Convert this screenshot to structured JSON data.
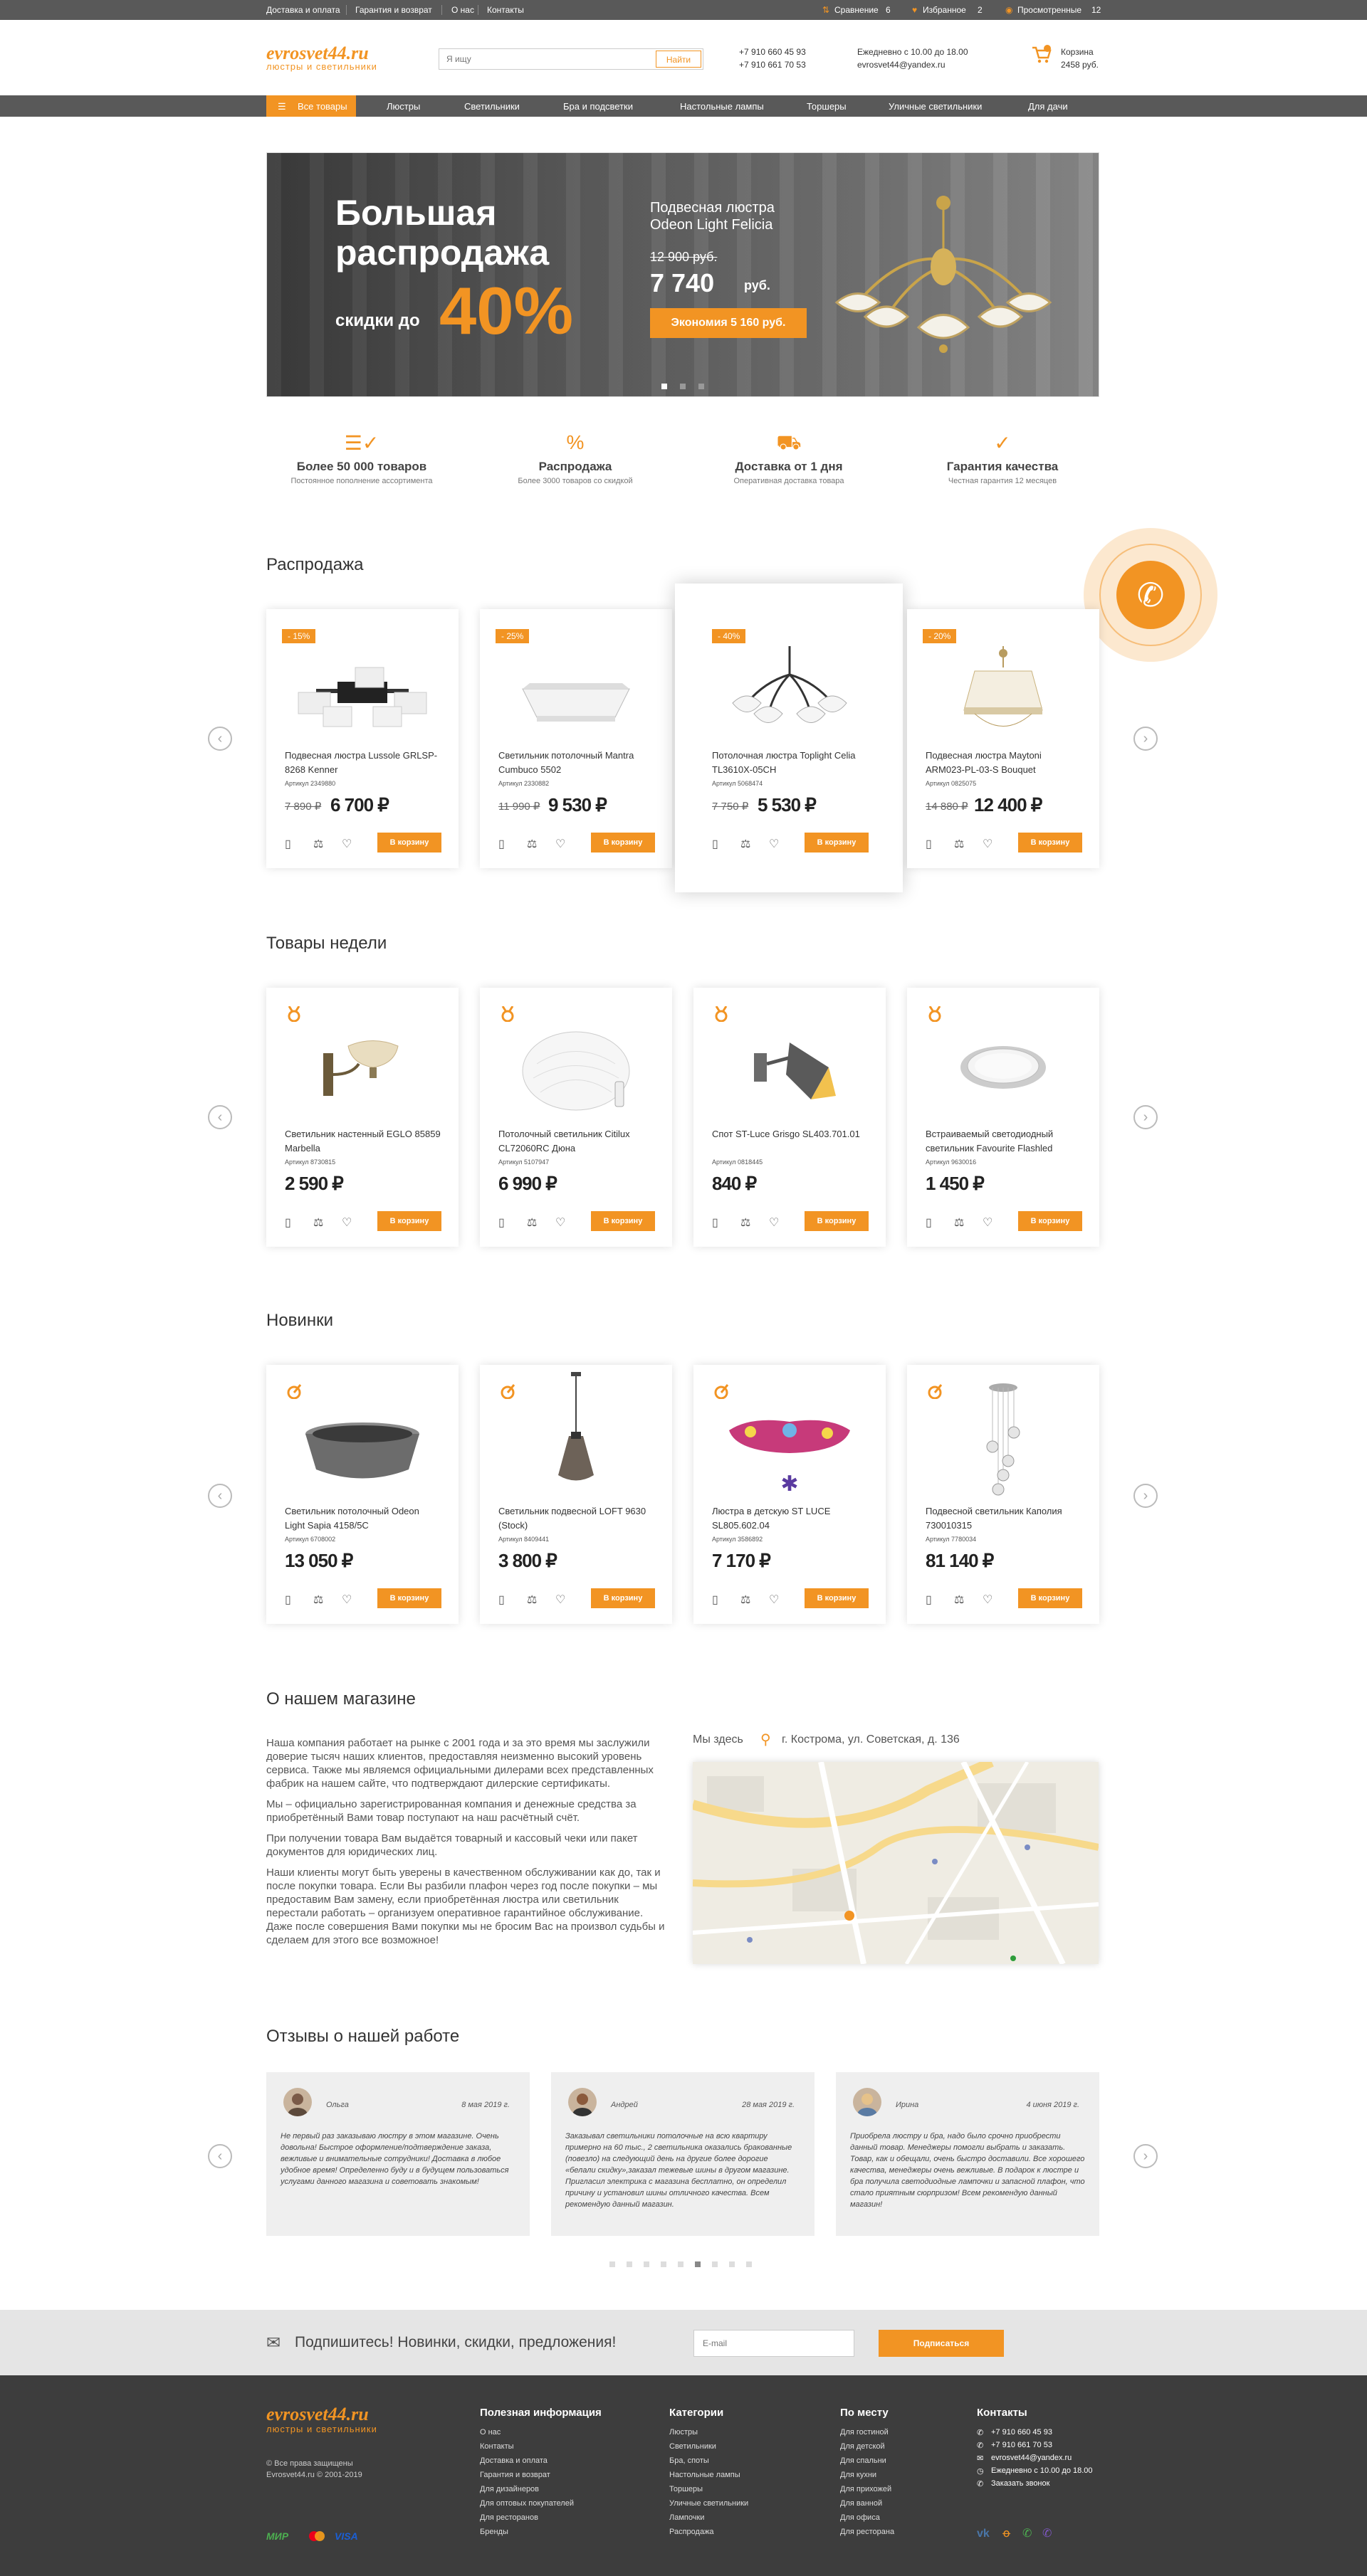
{
  "topbar": {
    "links": [
      "Доставка и оплата",
      "Гарантия и возврат",
      "О нас",
      "Контакты"
    ],
    "compare_label": "Сравнение",
    "compare_count": "6",
    "favorites_label": "Избранное",
    "favorites_count": "2",
    "viewed_label": "Просмотренные",
    "viewed_count": "12"
  },
  "header": {
    "logo_name": "evrosvet44.ru",
    "logo_sub": "люстры и светильники",
    "search_placeholder": "Я ищу",
    "search_button": "Найти",
    "phone1": "+7 910 660 45 93",
    "phone2": "+7 910 661 70 53",
    "hours": "Ежедневно с 10.00 до 18.00",
    "email": "evrosvet44@yandex.ru",
    "cart_label": "Корзина",
    "cart_sum": "2458 руб."
  },
  "nav": {
    "all": "Все товары",
    "items": [
      "Люстры",
      "Светильники",
      "Бра и подсветки",
      "Настольные лампы",
      "Торшеры",
      "Уличные светильники",
      "Для дачи"
    ]
  },
  "banner": {
    "line1": "Большая",
    "line2": "распродажа",
    "discount_prefix": "скидки до",
    "discount_value": "40%",
    "product_line1": "Подвесная люстра",
    "product_line2": "Odeon Light Felicia",
    "old_price": "12 900 руб.",
    "new_price": "7 740",
    "currency": "руб.",
    "economy": "Экономия 5 160 руб."
  },
  "features": [
    {
      "title": "Более 50 000 товаров",
      "sub": "Постоянное пополнение ассортимента",
      "icon": "checklist-icon"
    },
    {
      "title": "Распродажа",
      "sub": "Более 3000 товаров со скидкой",
      "icon": "percent-icon"
    },
    {
      "title": "Доставка от 1 дня",
      "sub": "Оперативная доставка товара",
      "icon": "truck-icon"
    },
    {
      "title": "Гарантия качества",
      "sub": "Честная гарантия 12 месяцев",
      "icon": "check-circle-icon"
    }
  ],
  "sale": {
    "title": "Распродажа",
    "items": [
      {
        "badge": "- 15%",
        "name": "Подвесная люстра Lussole GRLSP-8268 Kenner",
        "art": "Артикул 2349880",
        "old": "7 890 ₽",
        "price": "6 700 ₽"
      },
      {
        "badge": "- 25%",
        "name": "Светильник потолочный Mantra Cumbuco 5502",
        "art": "Артикул 2330882",
        "old": "11 990 ₽",
        "price": "9 530 ₽"
      },
      {
        "badge": "- 40%",
        "name": "Потолочная люстра Toplight Celia TL3610X-05CH",
        "art": "Артикул 5068474",
        "old": "7 750 ₽",
        "price": "5 530 ₽"
      },
      {
        "badge": "- 20%",
        "name": "Подвесная люстра Maytoni ARM023-PL-03-S Bouquet",
        "art": "Артикул 0825075",
        "old": "14 880 ₽",
        "price": "12 400 ₽"
      }
    ]
  },
  "week": {
    "title": "Товары недели",
    "items": [
      {
        "name": "Светильник настенный EGLO 85859 Marbella",
        "art": "Артикул 8730815",
        "price": "2 590 ₽"
      },
      {
        "name": "Потолочный светильник Citilux CL72060RC Дюна",
        "art": "Артикул 5107947",
        "price": "6 990 ₽"
      },
      {
        "name": "Спот ST-Luce Grisgo SL403.701.01",
        "art": "Артикул 0818445",
        "price": "840 ₽"
      },
      {
        "name": "Встраиваемый светодиодный светильник Favourite Flashled",
        "art": "Артикул 9630016",
        "price": "1 450 ₽"
      }
    ]
  },
  "new": {
    "title": "Новинки",
    "items": [
      {
        "name": "Светильник потолочный Odeon Light Sapia 4158/5C",
        "art": "Артикул 6708002",
        "price": "13 050 ₽"
      },
      {
        "name": "Светильник подвесной LOFT 9630 (Stock)",
        "art": "Артикул 8409441",
        "price": "3 800 ₽"
      },
      {
        "name": "Люстра в детскую ST LUCE SL805.602.04",
        "art": "Артикул 3586892",
        "price": "7 170 ₽"
      },
      {
        "name": "Подвесной светильник Каполия 730010315",
        "art": "Артикул 7780034",
        "price": "81 140 ₽"
      }
    ]
  },
  "card_cart_label": "В корзину",
  "about": {
    "title": "О нашем магазине",
    "p1": "Наша компания работает на рынке с 2001 года и за это время мы заслужили доверие тысяч наших клиентов, предоставляя неизменно высокий уровень сервиса. Также мы являемся официальными дилерами всех представленных фабрик на нашем сайте, что подтверждают дилерские сертификаты.",
    "p2": "Мы – официально зарегистрированная компания и денежные средства за приобретённый Вами товар поступают на наш расчётный счёт.",
    "p3": "При получении товара Вам выдаётся товарный и кассовый чеки или пакет документов для юридических лиц.",
    "p4": "Наши клиенты могут быть уверены в качественном обслуживании как до, так и после покупки товара. Если Вы разбили плафон через год после покупки – мы предоставим Вам замену, если приобретённая люстра или светильник перестали работать – организуем оперативное гарантийное обслуживание. Даже после совершения Вами покупки мы не бросим Вас на произвол судьбы и сделаем для этого все возможное!",
    "we_here": "Мы здесь",
    "address": "г. Кострома, ул. Советская, д. 136"
  },
  "reviews": {
    "title": "Отзывы о нашей работе",
    "items": [
      {
        "name": "Ольга",
        "date": "8 мая 2019 г.",
        "text": "Не первый раз заказываю люстру в этом магазине. Очень довольна! Быстрое оформление/подтверждение заказа, вежливые и внимательные сотрудники! Доставка в любое удобное время! Определенно буду и в будущем пользоваться услугами данного магазина и советовать знакомым!"
      },
      {
        "name": "Андрей",
        "date": "28 мая 2019 г.",
        "text": "Заказывал светильники потолочные на всю квартиру примерно на 60 тыс., 2 светильника оказались бракованные (повезло) на следующий день на другие более дорогие «белали скидку»,заказал тежевые шины в другом магазине. Пригласил электрика с магазина бесплатно, он определил причину и установил шины отличного качества. Всем рекомендую данный магазин."
      },
      {
        "name": "Ирина",
        "date": "4 июня 2019 г.",
        "text": "Приобрела люстру и бра, надо было срочно приобрести данный товар. Менеджеры помогли выбрать и заказать. Товар, как и обещали, очень быстро доставили. Все хорошего качества, менеджеры очень вежливые. В подарок к люстре и бра получила светодиодные лампочки и запасной плафон, что стало приятным сюрпризом! Всем рекомендую данный магазин!"
      }
    ]
  },
  "subscribe": {
    "text": "Подпишитесь! Новинки, скидки, предложения!",
    "placeholder": "E-mail",
    "button": "Подписаться"
  },
  "footer": {
    "logo_name": "evrosvet44.ru",
    "logo_sub": "люстры и светильники",
    "copy1": "© Все права защищены",
    "copy2": "Evrosvet44.ru © 2001-2019",
    "payments": [
      "МИР",
      "VISA"
    ],
    "col1_title": "Полезная информация",
    "col1": [
      "О нас",
      "Контакты",
      "Доставка и оплата",
      "Гарантия и возврат",
      "Для дизайнеров",
      "Для оптовых покупателей",
      "Для ресторанов",
      "Бренды"
    ],
    "col2_title": "Категории",
    "col2": [
      "Люстры",
      "Светильники",
      "Бра, споты",
      "Настольные лампы",
      "Торшеры",
      "Уличные светильники",
      "Лампочки",
      "Распродажа"
    ],
    "col3_title": "По месту",
    "col3": [
      "Для гостиной",
      "Для детской",
      "Для спальни",
      "Для кухни",
      "Для прихожей",
      "Для ванной",
      "Для офиса",
      "Для ресторана"
    ],
    "col4_title": "Контакты",
    "col4": [
      "+7 910 660 45 93",
      "+7 910 661 70 53",
      "evrosvet44@yandex.ru",
      "Ежедневно с 10.00 до 18.00",
      "Заказать звонок"
    ]
  },
  "colors": {
    "accent": "#f29423",
    "dark": "#595959",
    "footer": "#3d3d3d"
  }
}
